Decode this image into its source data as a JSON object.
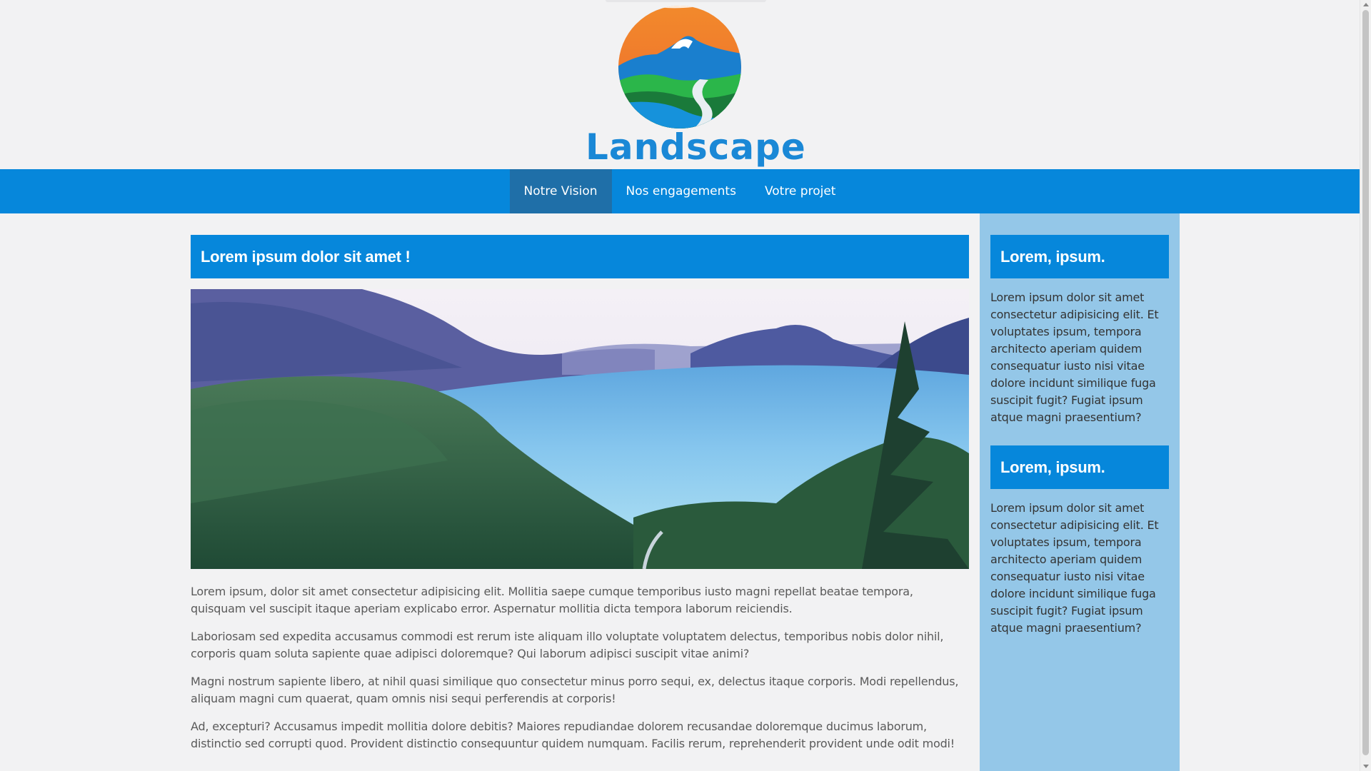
{
  "header": {
    "logo_text": "Landscape",
    "brand_color": "#1a88d6"
  },
  "nav": {
    "items": [
      {
        "label": "Notre Vision",
        "active": true
      },
      {
        "label": "Nos engagements",
        "active": false
      },
      {
        "label": "Votre projet",
        "active": false
      }
    ],
    "bg_color": "#0687db",
    "active_color": "#1f6fa8"
  },
  "main": {
    "title": "Lorem ipsum dolor sit amet !",
    "paragraphs": [
      "Lorem ipsum, dolor sit amet consectetur adipisicing elit. Mollitia saepe cumque temporibus iusto magni repellat beatae tempora, quisquam vel suscipit itaque aperiam explicabo error. Aspernatur mollitia dicta tempora laborum reiciendis.",
      "Laboriosam sed expedita accusamus commodi est rerum iste aliquam illo voluptate voluptatem delectus, temporibus nobis dolor nihil, corporis quam soluta sapiente quae adipisci doloremque? Qui laborum adipisci suscipit vitae animi?",
      "Magni nostrum sapiente libero, at nihil quasi similique quo consectetur minus porro sequi, ex, delectus itaque corporis. Modi repellendus, aliquam magni cum quaerat, quam omnis nisi sequi perferendis at corporis!",
      "Ad, excepturi? Accusamus impedit mollitia dolore debitis? Maiores repudiandae dolorem recusandae doloremque ducimus laborum, distinctio sed corrupti quod. Provident distinctio consequuntur quidem numquam. Facilis rerum, reprehenderit provident unde odit modi!"
    ]
  },
  "sidebar": {
    "bg_color": "#94c7e8",
    "blocks": [
      {
        "title": "Lorem, ipsum.",
        "text": "Lorem ipsum dolor sit amet consectetur adipisicing elit. Et voluptates ipsum, tempora architecto aperiam quidem consequatur iusto nisi vitae dolore incidunt similique fuga suscipit fugit? Fugiat ipsum atque magni praesentium?"
      },
      {
        "title": "Lorem, ipsum.",
        "text": "Lorem ipsum dolor sit amet consectetur adipisicing elit. Et voluptates ipsum, tempora architecto aperiam quidem consequatur iusto nisi vitae dolore incidunt similique fuga suscipit fugit? Fugiat ipsum atque magni praesentium?"
      }
    ]
  }
}
